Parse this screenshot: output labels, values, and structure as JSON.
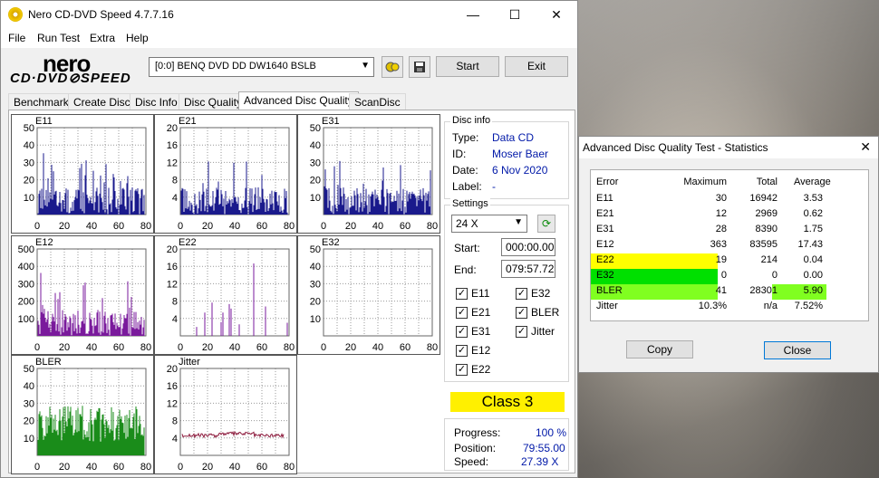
{
  "window": {
    "title": "Nero CD-DVD Speed 4.7.7.16",
    "minimize": "—",
    "maximize": "☐",
    "close": "✕"
  },
  "menu": [
    "File",
    "Run Test",
    "Extra",
    "Help"
  ],
  "logo": {
    "brand": "nero",
    "product": "CD·DVD⊘SPEED"
  },
  "toolbar": {
    "drive": "[0:0]   BENQ DVD DD DW1640 BSLB",
    "start": "Start",
    "exit": "Exit"
  },
  "tabs": [
    "Benchmark",
    "Create Disc",
    "Disc Info",
    "Disc Quality",
    "Advanced Disc Quality",
    "ScanDisc"
  ],
  "active_tab": "Advanced Disc Quality",
  "charts": [
    {
      "label": "E11",
      "y_ticks": [
        "50",
        "40",
        "30",
        "20",
        "10"
      ],
      "x_ticks": [
        "0",
        "20",
        "40",
        "60",
        "80"
      ],
      "color": "#1a1a8c"
    },
    {
      "label": "E21",
      "y_ticks": [
        "20",
        "16",
        "12",
        "8",
        "4"
      ],
      "x_ticks": [
        "0",
        "20",
        "40",
        "60",
        "80"
      ],
      "color": "#1a1a8c"
    },
    {
      "label": "E31",
      "y_ticks": [
        "50",
        "40",
        "30",
        "20",
        "10"
      ],
      "x_ticks": [
        "0",
        "20",
        "40",
        "60",
        "80"
      ],
      "color": "#1a1a8c"
    },
    {
      "label": "E12",
      "y_ticks": [
        "500",
        "400",
        "300",
        "200",
        "100"
      ],
      "x_ticks": [
        "0",
        "20",
        "40",
        "60",
        "80"
      ],
      "color": "#7a1a9c"
    },
    {
      "label": "E22",
      "y_ticks": [
        "20",
        "16",
        "12",
        "8",
        "4"
      ],
      "x_ticks": [
        "0",
        "20",
        "40",
        "60",
        "80"
      ],
      "color": "#7a1a9c"
    },
    {
      "label": "E32",
      "y_ticks": [
        "50",
        "40",
        "30",
        "20",
        "10"
      ],
      "x_ticks": [
        "0",
        "20",
        "40",
        "60",
        "80"
      ],
      "color": "#7a1a9c"
    },
    {
      "label": "BLER",
      "y_ticks": [
        "50",
        "40",
        "30",
        "20",
        "10"
      ],
      "x_ticks": [
        "0",
        "20",
        "40",
        "60",
        "80"
      ],
      "color": "#1a8c1a"
    },
    {
      "label": "Jitter",
      "y_ticks": [
        "20",
        "16",
        "12",
        "8",
        "4"
      ],
      "x_ticks": [
        "0",
        "20",
        "40",
        "60",
        "80"
      ],
      "color": "#8c1a3c"
    }
  ],
  "disc_info": {
    "title": "Disc info",
    "type_label": "Type:",
    "type": "Data CD",
    "id_label": "ID:",
    "id": "Moser Baer",
    "date_label": "Date:",
    "date": "6 Nov 2020",
    "label_label": "Label:",
    "label": "-"
  },
  "settings": {
    "title": "Settings",
    "speed": "24 X",
    "start_label": "Start:",
    "start": "000:00.00",
    "end_label": "End:",
    "end": "079:57.72"
  },
  "checkboxes": {
    "e11": "E11",
    "e32": "E32",
    "e21": "E21",
    "bler": "BLER",
    "e31": "E31",
    "jitter": "Jitter",
    "e12": "E12",
    "e22": "E22",
    "check": "✓"
  },
  "class_label": "Class 3",
  "progress": {
    "progress_label": "Progress:",
    "progress": "100 %",
    "position_label": "Position:",
    "position": "79:55.00",
    "speed_label": "Speed:",
    "speed": "27.39 X"
  },
  "stats": {
    "title": "Advanced Disc Quality Test - Statistics",
    "close_x": "✕",
    "headers": [
      "Error",
      "Maximum",
      "Total",
      "Average"
    ],
    "rows": [
      [
        "E11",
        "30",
        "16942",
        "3.53"
      ],
      [
        "E21",
        "12",
        "2969",
        "0.62"
      ],
      [
        "E31",
        "28",
        "8390",
        "1.75"
      ],
      [
        "E12",
        "363",
        "83595",
        "17.43"
      ],
      [
        "E22",
        "19",
        "214",
        "0.04"
      ],
      [
        "E32",
        "0",
        "0",
        "0.00"
      ],
      [
        "BLER",
        "41",
        "28301",
        "5.90"
      ],
      [
        "Jitter",
        "10.3%",
        "n/a",
        "7.52%"
      ]
    ],
    "copy": "Copy",
    "close": "Close",
    "highlight_yellow": "#ffff00",
    "highlight_green": "#00e000",
    "highlight_lime": "#80ff20"
  }
}
